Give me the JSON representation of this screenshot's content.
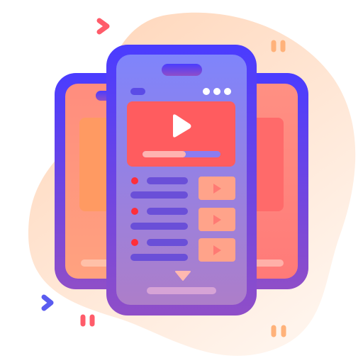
{
  "illustration": {
    "name": "video-streaming-app-icon",
    "icons": [
      "phone-icon",
      "play-icon",
      "chevron-right-icon",
      "pause-icon",
      "chevron-down-icon"
    ],
    "colors": {
      "blob_start": "#ffd9bf",
      "blob_end": "#fff3ea",
      "frame_start": "#4a3cff",
      "frame_end": "#8f4ec8",
      "screen_start": "#7f84fb",
      "screen_end": "#a97dcc",
      "back_screen_start": "#ff9a8a",
      "back_screen_end": "#ff7a7a",
      "video": "#ff5c5f",
      "thumb": "#ffa38a",
      "list_bar": "#6a4fd8",
      "dot": "#ff2e3a",
      "accent_orange": "#ffb27a",
      "accent_red": "#ff5c6a",
      "accent_blue": "#5a5cf0"
    },
    "video_progress": 0.5
  }
}
